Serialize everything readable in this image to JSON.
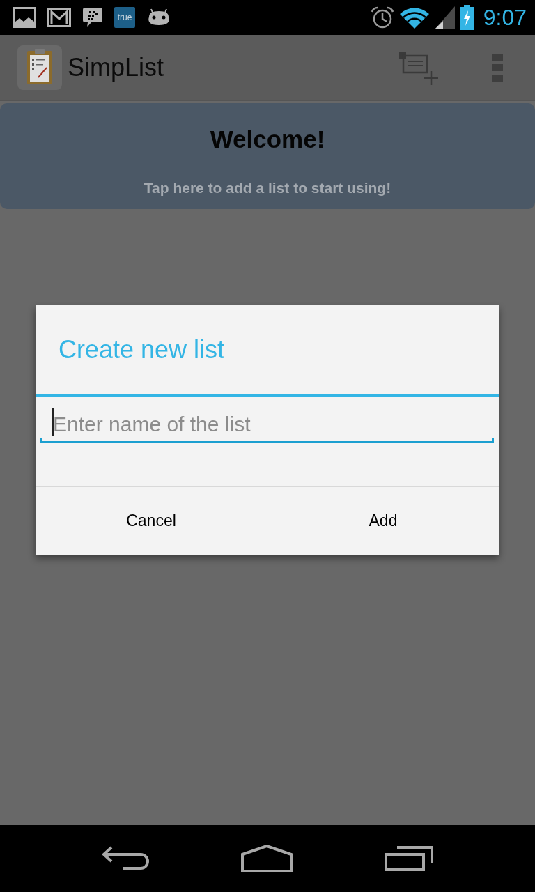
{
  "status_bar": {
    "badge_label": "true",
    "time": "9:07"
  },
  "action_bar": {
    "title": "SimpList"
  },
  "welcome_card": {
    "title": "Welcome!",
    "subtitle": "Tap here to add a list to start using!"
  },
  "dialog": {
    "title": "Create new list",
    "input": {
      "placeholder": "Enter name of the list",
      "focused": true
    },
    "buttons": [
      "Cancel",
      "Add"
    ]
  }
}
